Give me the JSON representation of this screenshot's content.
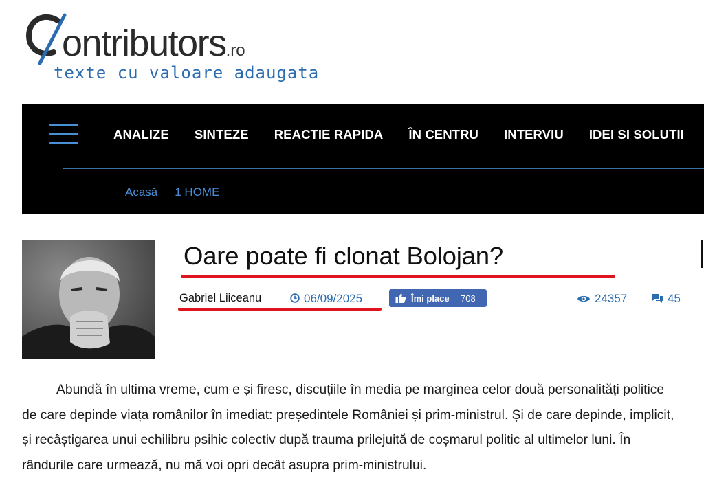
{
  "logo": {
    "wordmark": "ontributors",
    "domain_suffix": ".ro",
    "tagline": "texte cu valoare adaugata"
  },
  "nav": {
    "menu": [
      "ANALIZE",
      "SINTEZE",
      "REACTIE RAPIDA",
      "ÎN CENTRU",
      "INTERVIU",
      "IDEI SI SOLUTII"
    ]
  },
  "breadcrumb": {
    "home": "Acasă",
    "current": "1 HOME"
  },
  "article": {
    "title": "Oare poate fi clonat Bolojan?",
    "author": "Gabriel Liiceanu",
    "date": "06/09/2025",
    "like_label": "Îmi place",
    "like_count": "708",
    "views": "24357",
    "comments": "45",
    "body": "Abundă în ultima vreme, cum e și firesc, discuțiile în media pe marginea celor două personalități politice de care depinde viața românilor în imediat: președintele României și prim-ministrul. Și de care depinde, implicit, și recâștigarea unui echilibru psihic colectiv după trauma prilejuită de coșmarul politic al ultimelor luni. În rândurile care urmează, nu mă voi opri decât asupra prim-ministrului."
  },
  "colors": {
    "accent_blue": "#2b6cb0",
    "nav_bg": "#000000",
    "highlight_red": "#e0141e",
    "facebook_blue": "#4267b2"
  },
  "icons": [
    "hamburger-menu-icon",
    "clock-icon",
    "thumbs-up-icon",
    "eye-icon",
    "comment-icon"
  ]
}
